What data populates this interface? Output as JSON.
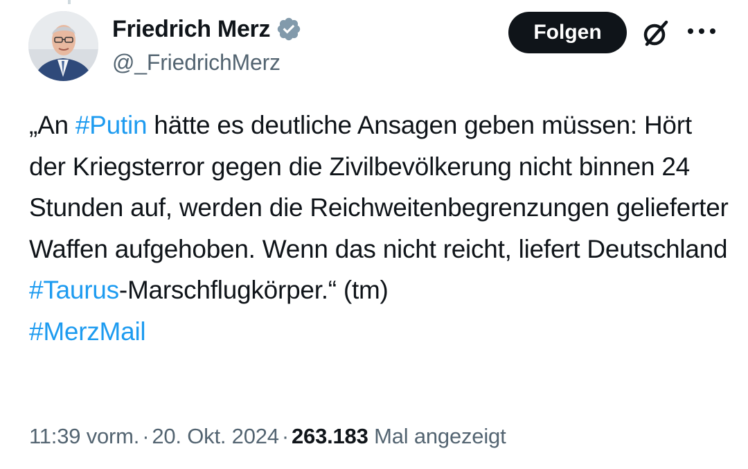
{
  "author": {
    "display_name": "Friedrich Merz",
    "handle": "@_FriedrichMerz",
    "verified": true
  },
  "actions": {
    "follow_label": "Folgen",
    "grok_icon": "grok-icon",
    "more_icon": "more-options-icon"
  },
  "tweet": {
    "segments": [
      {
        "text": "„An ",
        "type": "text"
      },
      {
        "text": "#Putin",
        "type": "hashtag"
      },
      {
        "text": " hätte es deutliche Ansagen geben müssen: Hört der Kriegsterror gegen die Zivilbevölkerung nicht binnen 24 Stunden auf, werden die Reichweitenbegrenzungen gelieferter Waffen aufgehoben. Wenn das nicht reicht, liefert Deutschland ",
        "type": "text"
      },
      {
        "text": "#Taurus",
        "type": "hashtag"
      },
      {
        "text": "-Marschflugkörper.“ (tm)",
        "type": "text"
      },
      {
        "text": "#MerzMail",
        "type": "hashtag"
      }
    ]
  },
  "meta": {
    "time": "11:39 vorm.",
    "separator": "·",
    "date": "20. Okt. 2024",
    "views_count": "263.183",
    "views_label": "Mal angezeigt"
  },
  "colors": {
    "text": "#0f1419",
    "secondary": "#536471",
    "link": "#1d9bf0",
    "button_bg": "#0f1419"
  }
}
